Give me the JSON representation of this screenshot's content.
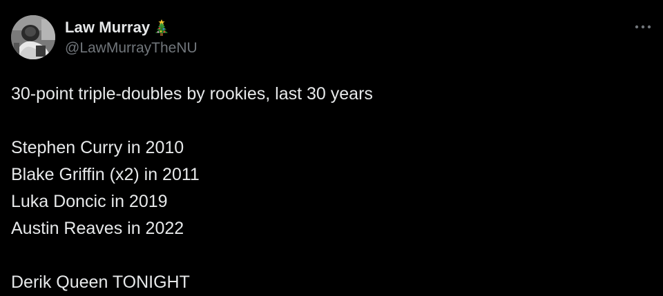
{
  "author": {
    "display_name": "Law Murray",
    "handle": "@LawMurrayTheNU",
    "badge_icon": "christmas-tree-icon",
    "avatar_icon": "profile-photo"
  },
  "menu": {
    "icon": "more-horizontal-icon"
  },
  "tweet": {
    "lines": [
      "30-point triple-doubles by rookies, last 30 years",
      "",
      "Stephen Curry in 2010",
      "Blake Griffin (x2) in 2011",
      "Luka Doncic in 2019",
      "Austin Reaves in 2022",
      "",
      "Derik Queen TONIGHT"
    ]
  },
  "colors": {
    "background": "#000000",
    "text_primary": "#e7e9ea",
    "text_secondary": "#71767b"
  }
}
